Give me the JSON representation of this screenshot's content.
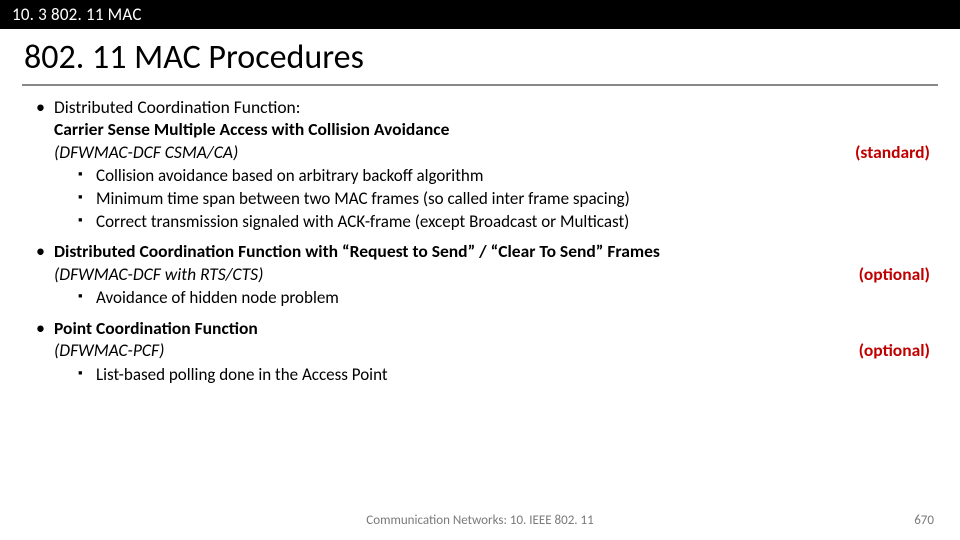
{
  "topbar": "10. 3 802. 11 MAC",
  "title": "802. 11 MAC Procedures",
  "items": [
    {
      "header_plain": "Distributed Coordination Function:",
      "line_bold": "Carrier Sense Multiple Access with Collision Avoidance",
      "line_paren": "(DFWMAC-DCF CSMA/CA)",
      "tag": "(standard)",
      "subs": [
        "Collision avoidance based on arbitrary backoff algorithm",
        "Minimum time span between two MAC frames (so called inter frame spacing)",
        "Correct transmission signaled with ACK-frame (except Broadcast or Multicast)"
      ]
    },
    {
      "header_bold": "Distributed Coordination Function with “Request to Send” / “Clear To Send” Frames",
      "line_paren": "(DFWMAC-DCF with RTS/CTS)",
      "tag": "(optional)",
      "subs": [
        "Avoidance of hidden node problem"
      ]
    },
    {
      "header_bold": "Point Coordination Function",
      "line_paren": "(DFWMAC-PCF)",
      "tag": "(optional)",
      "subs": [
        "List-based polling done in the Access Point"
      ]
    }
  ],
  "footer_center": "Communication Networks: 10. IEEE 802. 11",
  "page_number": "670"
}
